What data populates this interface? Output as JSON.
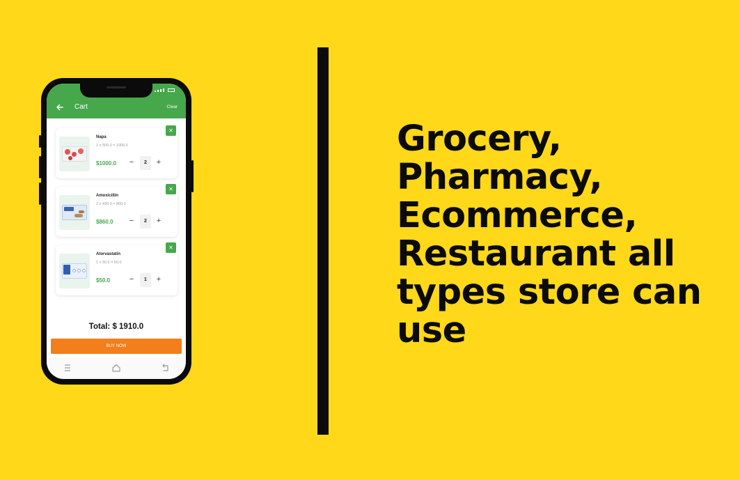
{
  "app": {
    "title": "Cart",
    "clear_label": "Clear",
    "back_icon": "arrow-left-icon",
    "accent_color": "#46A84B",
    "buy_color": "#F27F1B"
  },
  "cart": {
    "items": [
      {
        "name": "Napa",
        "calc": "2 x 500.0 = 1000.0",
        "price": "$1000.0",
        "qty": "2",
        "remove_icon": "close-icon",
        "minus": "−",
        "plus": "+"
      },
      {
        "name": "Amoxicillin",
        "calc": "2 x 430.0 = 860.0",
        "price": "$860.0",
        "qty": "2",
        "remove_icon": "close-icon",
        "minus": "−",
        "plus": "+"
      },
      {
        "name": "Atorvastatin",
        "calc": "1 x 50.0 = 50.0",
        "price": "$50.0",
        "qty": "1",
        "remove_icon": "close-icon",
        "minus": "−",
        "plus": "+"
      }
    ],
    "total": "Total: $ 1910.0",
    "buy_label": "BUY NOW"
  },
  "nav": {
    "items": [
      "menu-icon",
      "home-icon",
      "back-icon"
    ]
  },
  "headline": {
    "lines": [
      "Grocery,",
      "Pharmacy,",
      "Ecommerce,",
      "Restaurant all",
      "types store can",
      "use"
    ]
  },
  "background_color": "#FFD81A"
}
